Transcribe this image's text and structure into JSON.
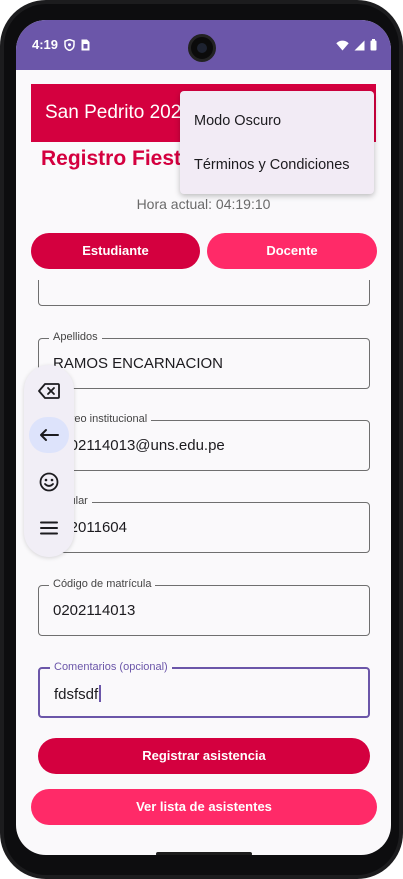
{
  "status_bar": {
    "time": "4:19",
    "left_icons": [
      "shield-icon",
      "sim-card-icon"
    ],
    "right_icons": [
      "wifi-icon",
      "signal-icon",
      "battery-icon"
    ]
  },
  "app_bar": {
    "title": "San Pedrito 2023",
    "color": "#d4003f"
  },
  "menu": {
    "items": [
      "Modo Oscuro",
      "Términos y Condiciones"
    ]
  },
  "page": {
    "heading": "Registro Fiesta",
    "clock": "Hora actual: 04:19:10"
  },
  "tabs": [
    {
      "label": "Estudiante",
      "selected": true,
      "color": "#d4003f"
    },
    {
      "label": "Docente",
      "selected": false,
      "color": "#ff2a68"
    }
  ],
  "form": {
    "fields": [
      {
        "label": "",
        "value": ""
      },
      {
        "label": "Apellidos",
        "value": "RAMOS ENCARNACION"
      },
      {
        "label": "Correo institucional",
        "value": "0202114013@uns.edu.pe"
      },
      {
        "label": "Celular",
        "value": "992011604"
      },
      {
        "label": "Código de matrícula",
        "value": "0202114013"
      },
      {
        "label": "Comentarios (opcional)",
        "value": "fdsfsdf"
      }
    ]
  },
  "buttons": {
    "register": "Registrar asistencia",
    "list": "Ver lista de asistentes"
  },
  "toolbar": {
    "icons": [
      "backspace-icon",
      "enter-icon",
      "emoji-icon",
      "menu-icon"
    ],
    "accent": "#6b56a9"
  }
}
